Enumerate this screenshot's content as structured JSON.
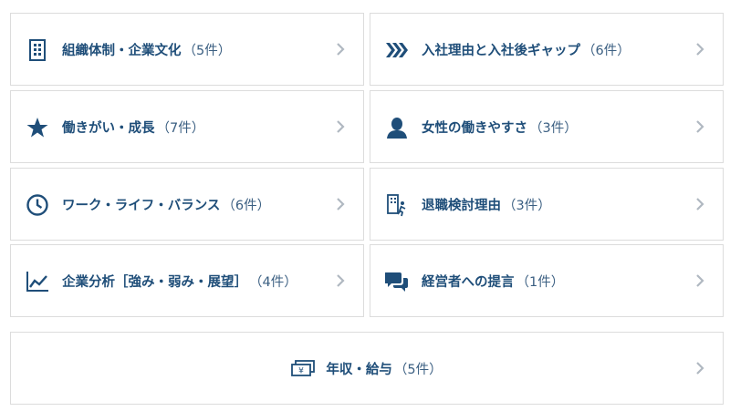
{
  "categories": [
    {
      "title": "組織体制・企業文化",
      "count": "（5件）",
      "icon": "building-icon"
    },
    {
      "title": "入社理由と入社後ギャップ",
      "count": "（6件）",
      "icon": "triple-chevron-icon"
    },
    {
      "title": "働きがい・成長",
      "count": "（7件）",
      "icon": "star-icon"
    },
    {
      "title": "女性の働きやすさ",
      "count": "（3件）",
      "icon": "woman-icon"
    },
    {
      "title": "ワーク・ライフ・バランス",
      "count": "（6件）",
      "icon": "clock-icon"
    },
    {
      "title": "退職検討理由",
      "count": "（3件）",
      "icon": "exit-building-icon"
    },
    {
      "title": "企業分析［強み・弱み・展望］",
      "count": "（4件）",
      "icon": "line-chart-icon"
    },
    {
      "title": "経営者への提言",
      "count": "（1件）",
      "icon": "speech-bubbles-icon"
    }
  ],
  "salary": {
    "title": "年収・給与",
    "count": "（5件）",
    "icon": "yen-bill-icon"
  },
  "colors": {
    "accent": "#1f4e79",
    "border": "#dcdcdc",
    "chevron": "#b0b8c1"
  }
}
